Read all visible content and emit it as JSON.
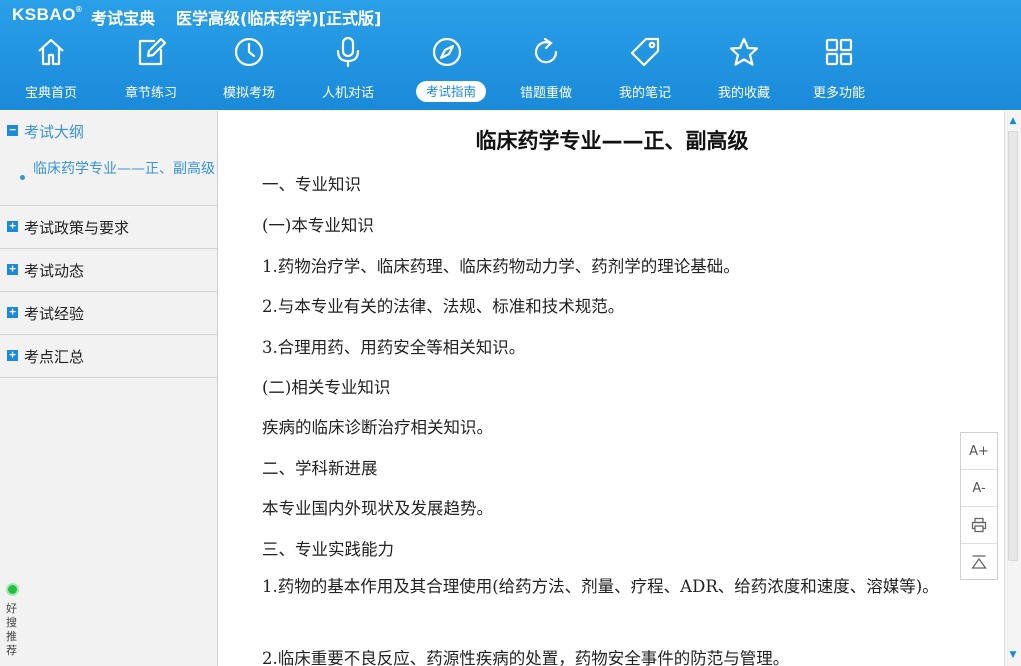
{
  "header": {
    "logo": "KSBAO",
    "logo_cn": "考试宝典",
    "app_title": "医学高级(临床药学)[正式版]"
  },
  "nav": [
    {
      "label": "宝典首页",
      "icon": "home-icon"
    },
    {
      "label": "章节练习",
      "icon": "edit-icon"
    },
    {
      "label": "模拟考场",
      "icon": "clock-icon"
    },
    {
      "label": "人机对话",
      "icon": "microphone-icon"
    },
    {
      "label": "考试指南",
      "icon": "compass-icon",
      "active": true
    },
    {
      "label": "错题重做",
      "icon": "redo-icon"
    },
    {
      "label": "我的笔记",
      "icon": "tag-icon"
    },
    {
      "label": "我的收藏",
      "icon": "star-icon"
    },
    {
      "label": "更多功能",
      "icon": "grid-icon"
    }
  ],
  "sidebar": {
    "groups": [
      {
        "label": "考试大纲",
        "expanded": true,
        "children": [
          "临床药学专业——正、副高级"
        ]
      },
      {
        "label": "考试政策与要求",
        "expanded": false
      },
      {
        "label": "考试动态",
        "expanded": false
      },
      {
        "label": "考试经验",
        "expanded": false
      },
      {
        "label": "考点汇总",
        "expanded": false
      }
    ],
    "recommend": "好搜推荐"
  },
  "content": {
    "title": "临床药学专业——正、副高级",
    "paragraphs": [
      "一、专业知识",
      "(一)本专业知识",
      "1.药物治疗学、临床药理、临床药物动力学、药剂学的理论基础。",
      "2.与本专业有关的法律、法规、标准和技术规范。",
      "3.合理用药、用药安全等相关知识。",
      "(二)相关专业知识",
      "疾病的临床诊断治疗相关知识。",
      "二、学科新进展",
      "本专业国内外现状及发展趋势。",
      "三、专业实践能力",
      "1.药物的基本作用及其合理使用(给药方法、剂量、疗程、ADR、给药浓度和速度、溶媒等)。",
      "2.临床重要不良反应、药源性疾病的处置，药物安全事件的防范与管理。"
    ]
  },
  "tools": {
    "font_up": "A+",
    "font_down": "A-",
    "print_icon": "print-icon",
    "top_icon": "back-to-top-icon"
  },
  "colors": {
    "header_blue": "#1a8ad9",
    "link_blue": "#3a93d6",
    "sidebar_bg": "#f2f2f2"
  }
}
